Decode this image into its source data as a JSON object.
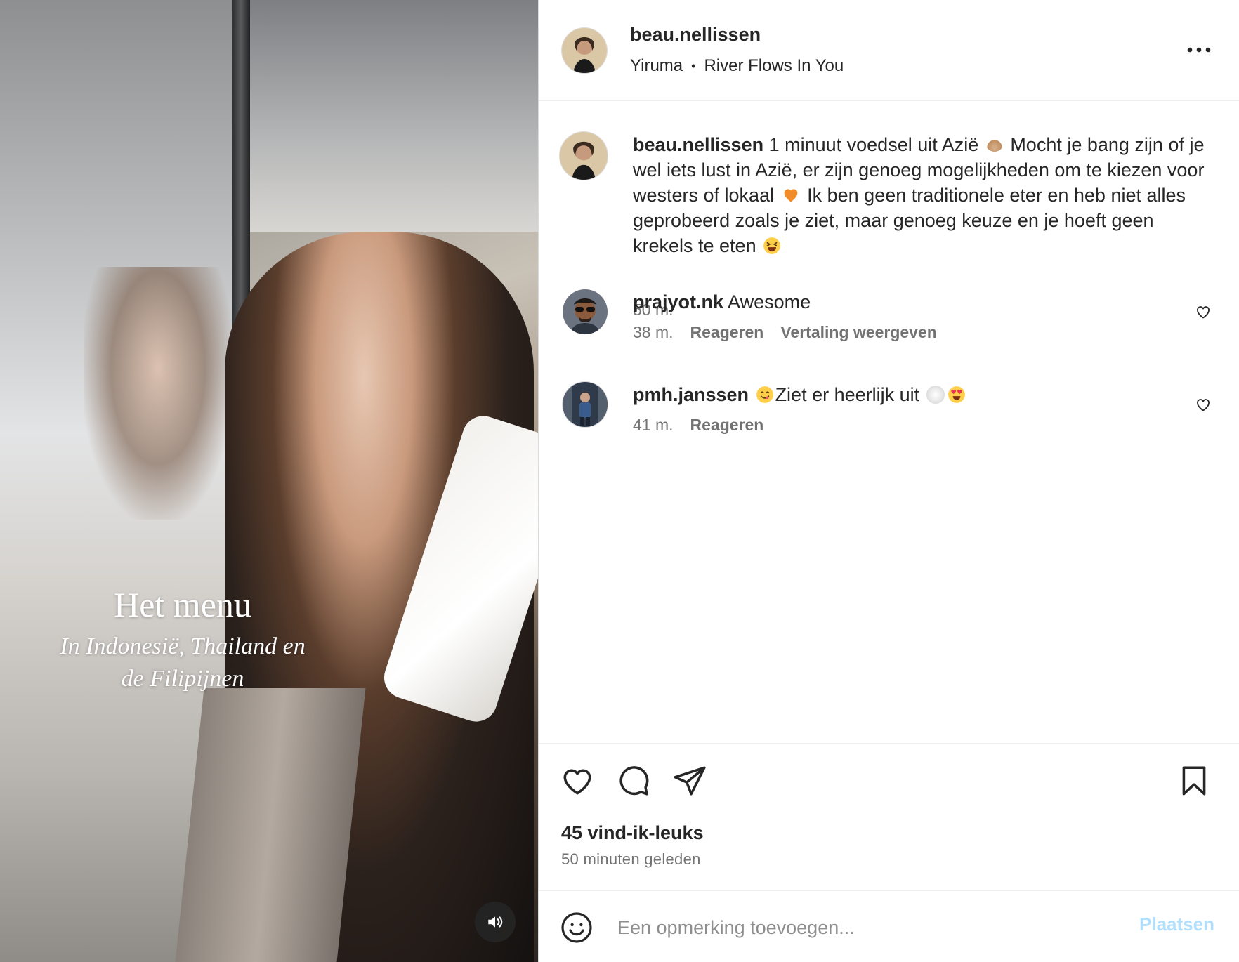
{
  "media": {
    "overlay_title": "Het menu",
    "overlay_subtitle_line1": "In Indonesië, Thailand en",
    "overlay_subtitle_line2": "de Filipijnen",
    "mute_icon": "speaker-on-icon"
  },
  "header": {
    "username": "beau.nellissen",
    "audio_artist": "Yiruma",
    "audio_separator": "•",
    "audio_track": "River Flows In You",
    "more_icon": "more-horizontal-icon"
  },
  "caption": {
    "username": "beau.nellissen",
    "text_part1": "1 minuut voedsel uit Azië",
    "text_part2": "Mocht je bang zijn of je wel iets lust in Azië, er zijn genoeg mogelijkheden om te kiezen voor westers of lokaal",
    "text_part3": "Ik ben geen traditionele eter en heb niet alles geprobeerd zoals je ziet, maar genoeg keuze en je hoeft geen krekels te eten",
    "time": "50 m."
  },
  "comments": [
    {
      "username": "prajyot.nk",
      "text": "Awesome",
      "time": "38 m.",
      "reply_label": "Reageren",
      "translate_label": "Vertaling weergeven"
    },
    {
      "username": "pmh.janssen",
      "text": "Ziet er heerlijk uit",
      "time": "41 m.",
      "reply_label": "Reageren"
    }
  ],
  "actions": {
    "like_icon": "heart-icon",
    "comment_icon": "comment-bubble-icon",
    "share_icon": "paper-plane-icon",
    "save_icon": "bookmark-icon"
  },
  "stats": {
    "likes": "45 vind-ik-leuks",
    "time_ago": "50 minuten geleden"
  },
  "add_comment": {
    "placeholder": "Een opmerking toevoegen...",
    "post_label": "Plaatsen",
    "emoji_icon": "smiley-icon"
  },
  "colors": {
    "text": "#262626",
    "secondary": "#737373",
    "post_disabled": "#b2dffc",
    "border": "#dbdbdb"
  }
}
